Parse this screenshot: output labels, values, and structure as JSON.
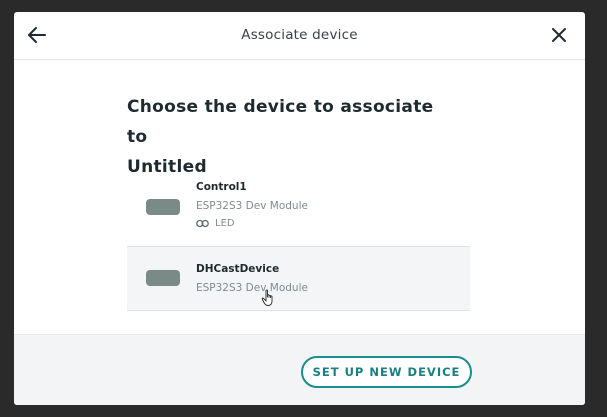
{
  "dialog": {
    "title": "Associate device",
    "back_icon": "arrow-left-icon",
    "close_icon": "close-icon"
  },
  "heading": {
    "line1": "Choose the device to associate to",
    "line2": "Untitled"
  },
  "devices": [
    {
      "name": "Control1",
      "board": "ESP32S3 Dev Module",
      "variable": "LED",
      "variable_icon": "link-icon",
      "icon": "board-icon",
      "state": "default"
    },
    {
      "name": "DHCastDevice",
      "board": "ESP32S3 Dev Module",
      "icon": "board-icon",
      "state": "hover"
    }
  ],
  "footer": {
    "setup_button": "SET UP NEW DEVICE"
  },
  "colors": {
    "accent": "#1a8d8d",
    "text_primary": "#1f2a2e",
    "text_secondary": "#7f8b90",
    "board_icon": "#7a8a86",
    "hover_row": "#f3f5f6"
  }
}
